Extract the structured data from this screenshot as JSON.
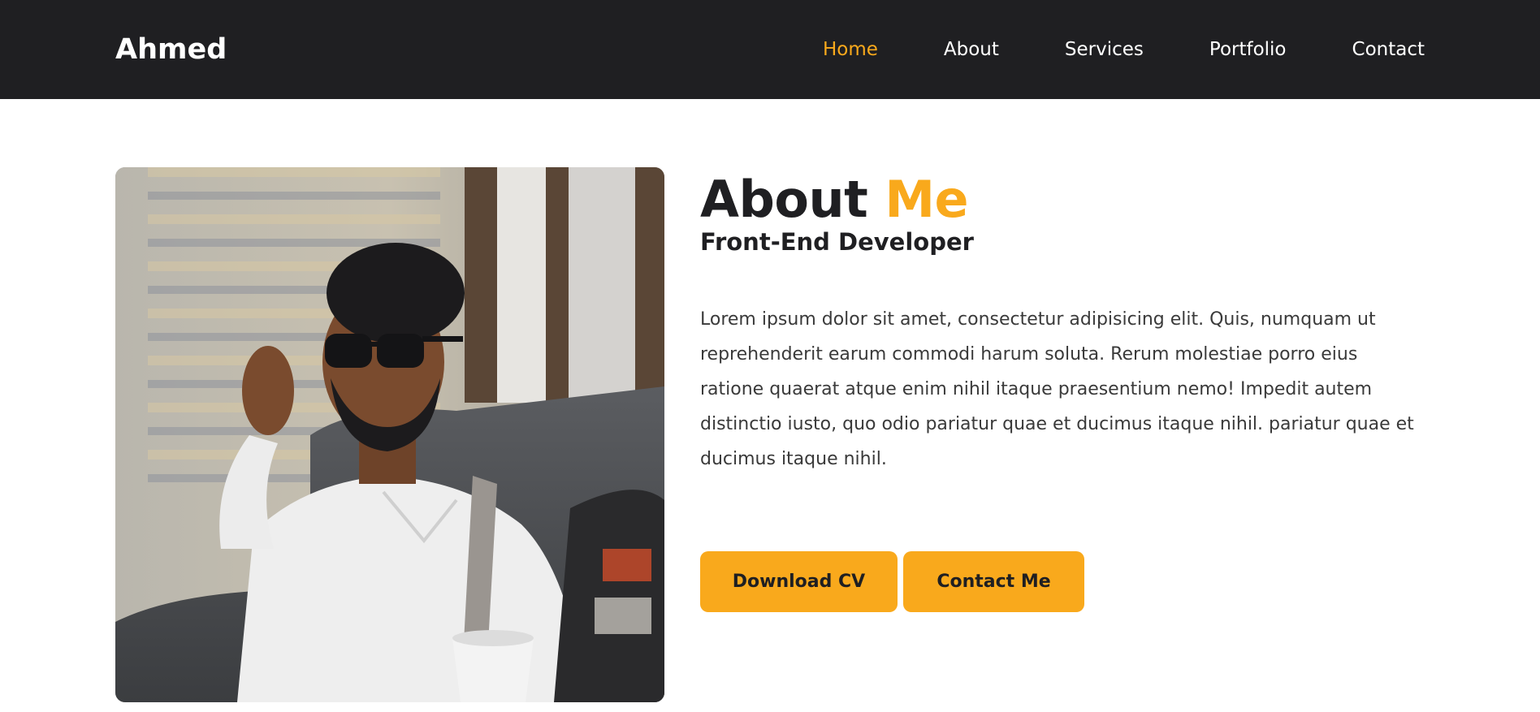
{
  "navbar": {
    "logo": "Ahmed",
    "links": [
      {
        "label": "Home",
        "active": true
      },
      {
        "label": "About",
        "active": false
      },
      {
        "label": "Services",
        "active": false
      },
      {
        "label": "Portfolio",
        "active": false
      },
      {
        "label": "Contact",
        "active": false
      }
    ]
  },
  "about": {
    "title_main": "About",
    "title_accent": "Me",
    "subtitle": "Front-End Developer",
    "paragraph": "Lorem ipsum dolor sit amet, consectetur adipisicing elit. Quis, numquam ut reprehenderit earum commodi harum soluta. Rerum molestiae porro eius ratione quaerat atque enim nihil itaque praesentium nemo! Impedit autem distinctio iusto, quo odio pariatur quae et ducimus itaque nihil. pariatur quae et ducimus itaque nihil.",
    "buttons": {
      "download_cv": "Download CV",
      "contact_me": "Contact Me"
    }
  },
  "colors": {
    "accent": "#f9a91c",
    "navbar_bg": "#1f1f22",
    "text_dark": "#1f1f22"
  }
}
